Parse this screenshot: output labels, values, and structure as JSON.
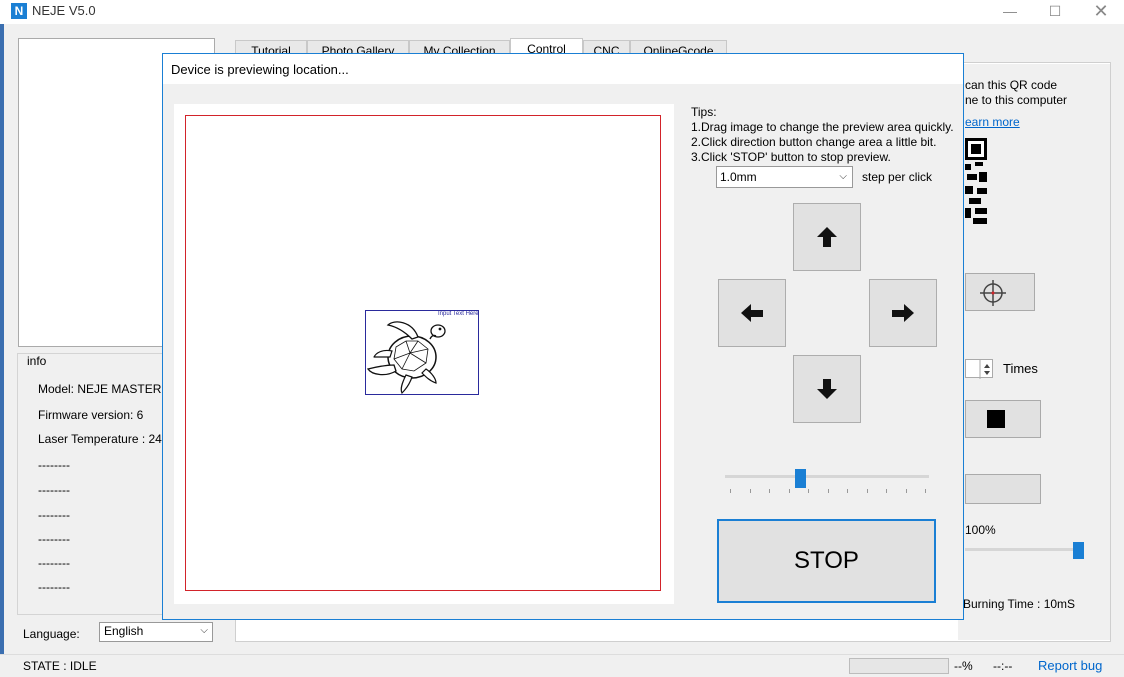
{
  "app": {
    "title": "NEJE V5.0",
    "icon_letter": "N",
    "window_controls": [
      "minimize-icon",
      "maximize-icon",
      "close-icon"
    ]
  },
  "tabs": [
    {
      "label": "Tutorial"
    },
    {
      "label": "Photo Gallery"
    },
    {
      "label": "My Collection"
    },
    {
      "label": "Control",
      "active": true
    },
    {
      "label": "CNC"
    },
    {
      "label": "OnlineGcode"
    }
  ],
  "info": {
    "title": "info",
    "model": "Model: NEJE MASTER",
    "firmware": "Firmware version: 6",
    "laser_temp": "Laser Temperature : 24",
    "placeholders": [
      "--------",
      "--------",
      "--------",
      "--------",
      "--------",
      "--------"
    ]
  },
  "language": {
    "label": "Language:",
    "value": "English"
  },
  "status": {
    "state": "STATE : IDLE",
    "progress_pct": "--%",
    "time": "--:--",
    "report_bug": "Report bug",
    "progress_value": 0
  },
  "right_panel": {
    "qr_line1": "can this QR code",
    "qr_line2": "ne to this computer",
    "learn_more": "earn more",
    "times_label": "Times",
    "power_pct": "100%",
    "power_value": 1.0,
    "burning_time": "Burning Time : 10mS"
  },
  "dialog": {
    "title": "Device is previewing location...",
    "image_text": "Input Text Here",
    "tips_title": "Tips:",
    "tips": [
      "1.Drag image to change the preview area quickly.",
      "2.Click direction button change area a little bit.",
      "3.Click 'STOP' button to stop preview."
    ],
    "step_value": "1.0mm",
    "step_label": "step per click",
    "speed_value": 0.37,
    "stop_label": "STOP"
  },
  "colors": {
    "accent": "#1a7fd4",
    "frame": "#d2232a",
    "link": "#0066cc"
  }
}
